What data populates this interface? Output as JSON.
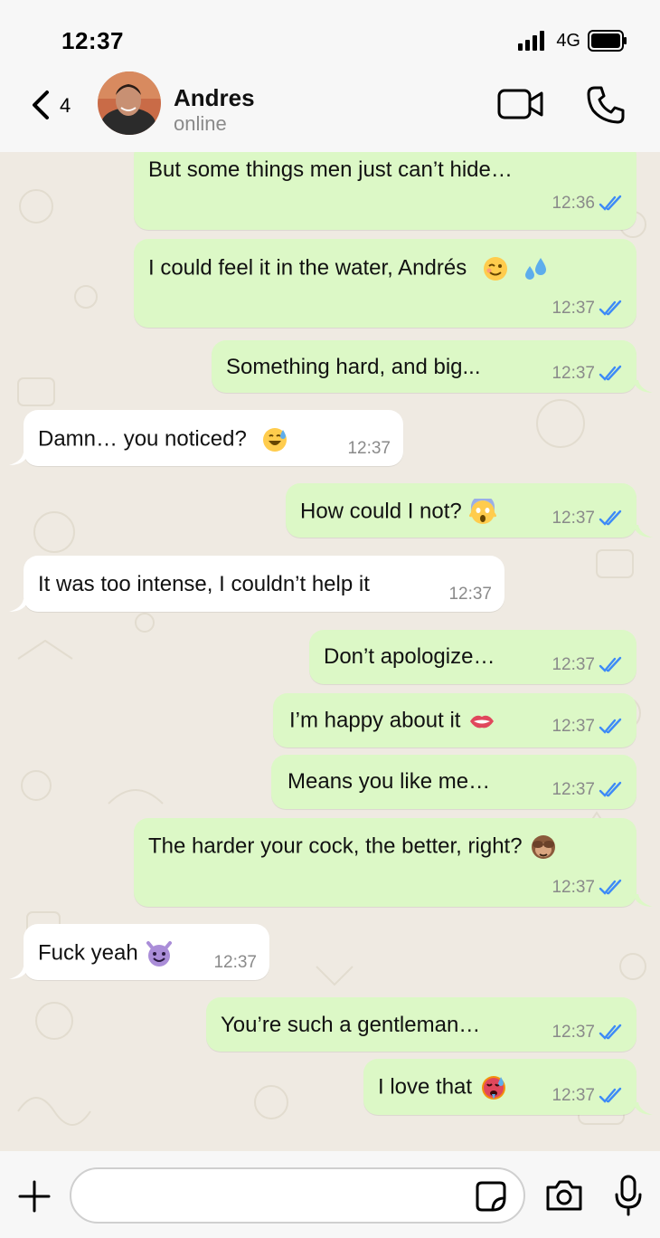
{
  "status_bar": {
    "time": "12:37",
    "network": "4G"
  },
  "header": {
    "back_count": "4",
    "contact_name": "Andres",
    "contact_status": "online",
    "icons": [
      "back-chevron-icon",
      "video-call-icon",
      "phone-call-icon"
    ]
  },
  "messages": [
    {
      "dir": "out",
      "text": "But some things men just can’t hide…",
      "time": "12:36",
      "emoji": ""
    },
    {
      "dir": "out",
      "text": "I could feel it in the water, Andrés",
      "time": "12:37",
      "emoji": "winking-face, droplets"
    },
    {
      "dir": "out",
      "text": "Something hard, and big...",
      "time": "12:37",
      "emoji": ""
    },
    {
      "dir": "in",
      "text": "Damn… you noticed?",
      "time": "12:37",
      "emoji": "grinning-sweat-face"
    },
    {
      "dir": "out",
      "text": "How could I not?",
      "time": "12:37",
      "emoji": "screaming-face"
    },
    {
      "dir": "in",
      "text": "It was too intense, I couldn’t help it",
      "time": "12:37",
      "emoji": ""
    },
    {
      "dir": "out",
      "text": "Don’t apologize…",
      "time": "12:37",
      "emoji": ""
    },
    {
      "dir": "out",
      "text": "I’m happy about it",
      "time": "12:37",
      "emoji": "biting-lip"
    },
    {
      "dir": "out",
      "text": "Means you like me…",
      "time": "12:37",
      "emoji": ""
    },
    {
      "dir": "out",
      "text": "The harder your cock, the better, right?",
      "time": "12:37",
      "emoji": "see-no-evil-monkey"
    },
    {
      "dir": "in",
      "text": "Fuck yeah",
      "time": "12:37",
      "emoji": "smiling-devil"
    },
    {
      "dir": "out",
      "text": "You’re such a gentleman…",
      "time": "12:37",
      "emoji": ""
    },
    {
      "dir": "out",
      "text": "I love that",
      "time": "12:37",
      "emoji": "hot-face"
    }
  ],
  "composer": {
    "input_value": "",
    "icons": [
      "plus-icon",
      "sticker-icon",
      "camera-icon",
      "microphone-icon"
    ]
  },
  "colors": {
    "outgoing_bubble": "#dcf8c6",
    "incoming_bubble": "#ffffff",
    "read_tick": "#3d8af7",
    "chat_background": "#efeae2"
  }
}
